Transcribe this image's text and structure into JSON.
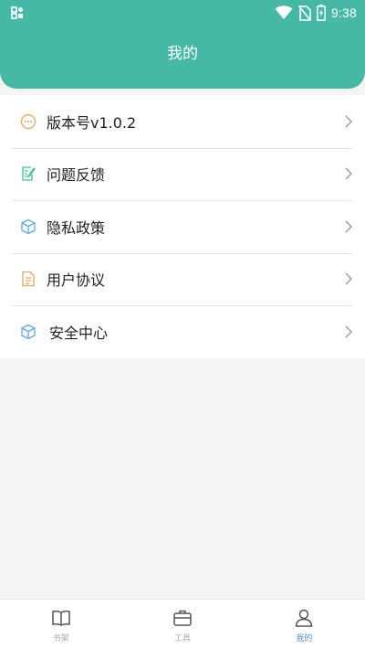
{
  "status_bar": {
    "time": "9:38"
  },
  "header": {
    "title": "我的",
    "background_color": "#45b9a5"
  },
  "menu": {
    "items": [
      {
        "label": "版本号v1.0.2",
        "icon": "more-circle-icon",
        "icon_color": "#e7a45a"
      },
      {
        "label": "问题反馈",
        "icon": "edit-note-icon",
        "icon_color": "#3dbf9f"
      },
      {
        "label": "隐私政策",
        "icon": "cube-icon",
        "icon_color": "#5aa8e6"
      },
      {
        "label": "用户协议",
        "icon": "document-icon",
        "icon_color": "#e7a45a"
      },
      {
        "label": "安全中心",
        "icon": "cube-icon",
        "icon_color": "#5aa8e6"
      }
    ]
  },
  "bottom_nav": {
    "items": [
      {
        "label": "书架",
        "icon": "book-icon",
        "active": false
      },
      {
        "label": "工具",
        "icon": "toolbox-icon",
        "active": false
      },
      {
        "label": "我的",
        "icon": "user-icon",
        "active": true
      }
    ],
    "active_color": "#4a8fd9"
  }
}
